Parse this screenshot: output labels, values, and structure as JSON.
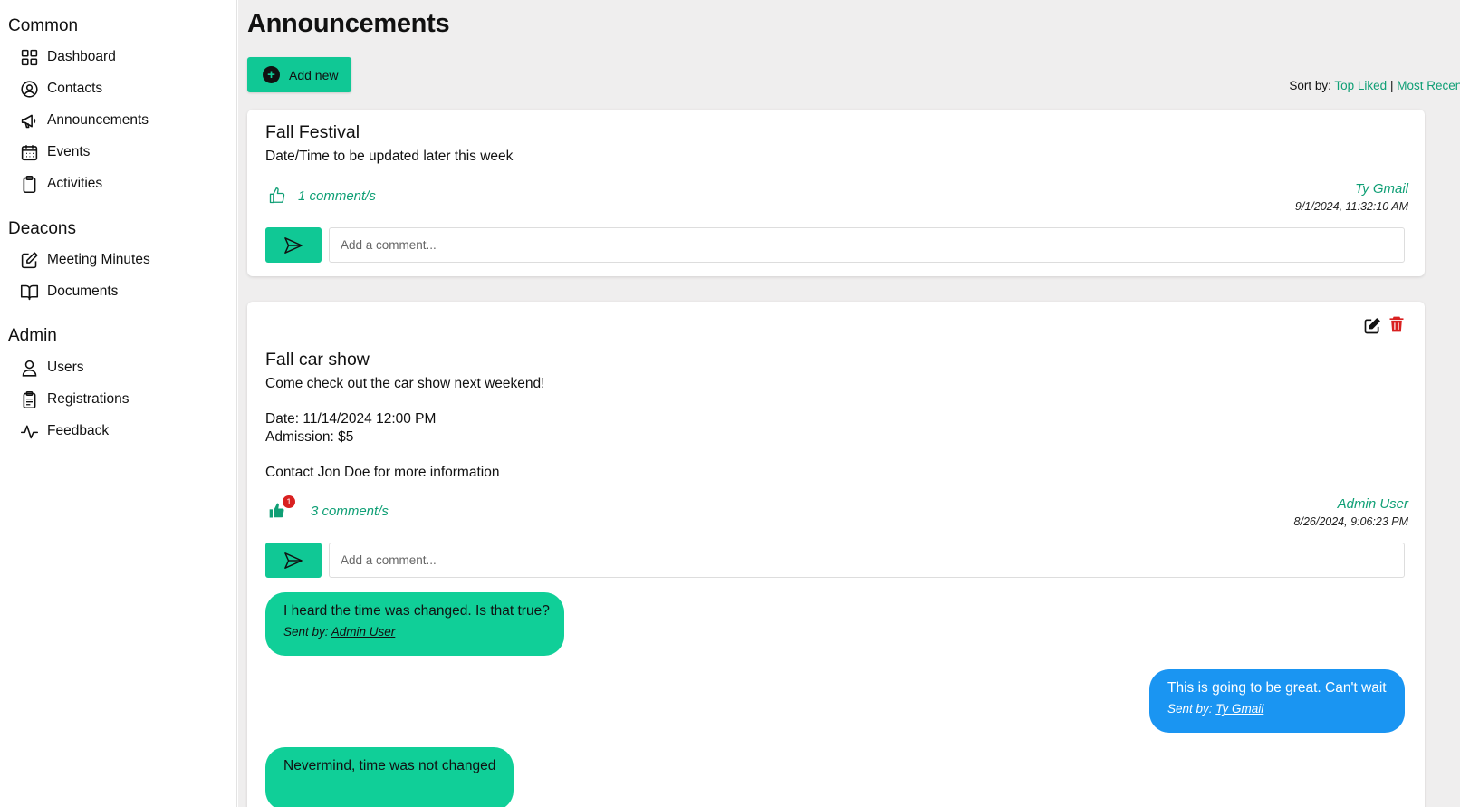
{
  "sidebar": {
    "sections": [
      {
        "title": "Common",
        "items": [
          {
            "label": "Dashboard",
            "icon": "dashboard-grid-icon"
          },
          {
            "label": "Contacts",
            "icon": "user-circle-icon"
          },
          {
            "label": "Announcements",
            "icon": "megaphone-icon"
          },
          {
            "label": "Events",
            "icon": "calendar-icon"
          },
          {
            "label": "Activities",
            "icon": "clipboard-icon"
          }
        ]
      },
      {
        "title": "Deacons",
        "items": [
          {
            "label": "Meeting Minutes",
            "icon": "edit-square-icon"
          },
          {
            "label": "Documents",
            "icon": "book-icon"
          }
        ]
      },
      {
        "title": "Admin",
        "items": [
          {
            "label": "Users",
            "icon": "person-icon"
          },
          {
            "label": "Registrations",
            "icon": "clipboard-list-icon"
          },
          {
            "label": "Feedback",
            "icon": "activity-pulse-icon"
          }
        ]
      }
    ]
  },
  "main": {
    "title": "Announcements",
    "add_button": "Add new",
    "sort": {
      "label": "Sort by:",
      "top_liked": "Top Liked",
      "separator": "|",
      "most_recent": "Most Recent"
    },
    "comment_placeholder": "Add a comment...",
    "announcements": [
      {
        "title": "Fall Festival",
        "body": "Date/Time to be updated later this week",
        "liked": false,
        "comment_count": "1 comment/s",
        "author": "Ty Gmail",
        "timestamp": "9/1/2024, 11:32:10 AM"
      },
      {
        "title": "Fall car show",
        "body": "Come check out the car show next weekend!\n\nDate: 11/14/2024 12:00 PM\nAdmission: $5\n\nContact Jon Doe for more information",
        "liked": true,
        "like_badge": "1",
        "comment_count": "3 comment/s",
        "author": "Admin User",
        "timestamp": "8/26/2024, 9:06:23 PM",
        "comments": [
          {
            "text": "I heard the time was changed. Is that true?",
            "sent_label": "Sent by:",
            "sender": "Admin User",
            "side": "left"
          },
          {
            "text": "This is going to be great. Can't wait",
            "sent_label": "Sent by:",
            "sender": "Ty Gmail",
            "side": "right"
          },
          {
            "text": "Nevermind, time was not changed",
            "side": "left"
          }
        ]
      }
    ]
  },
  "colors": {
    "accent": "#10c895",
    "accent_text": "#0f9f75",
    "sent_bubble": "#1a95f2",
    "delete": "#d92020"
  }
}
